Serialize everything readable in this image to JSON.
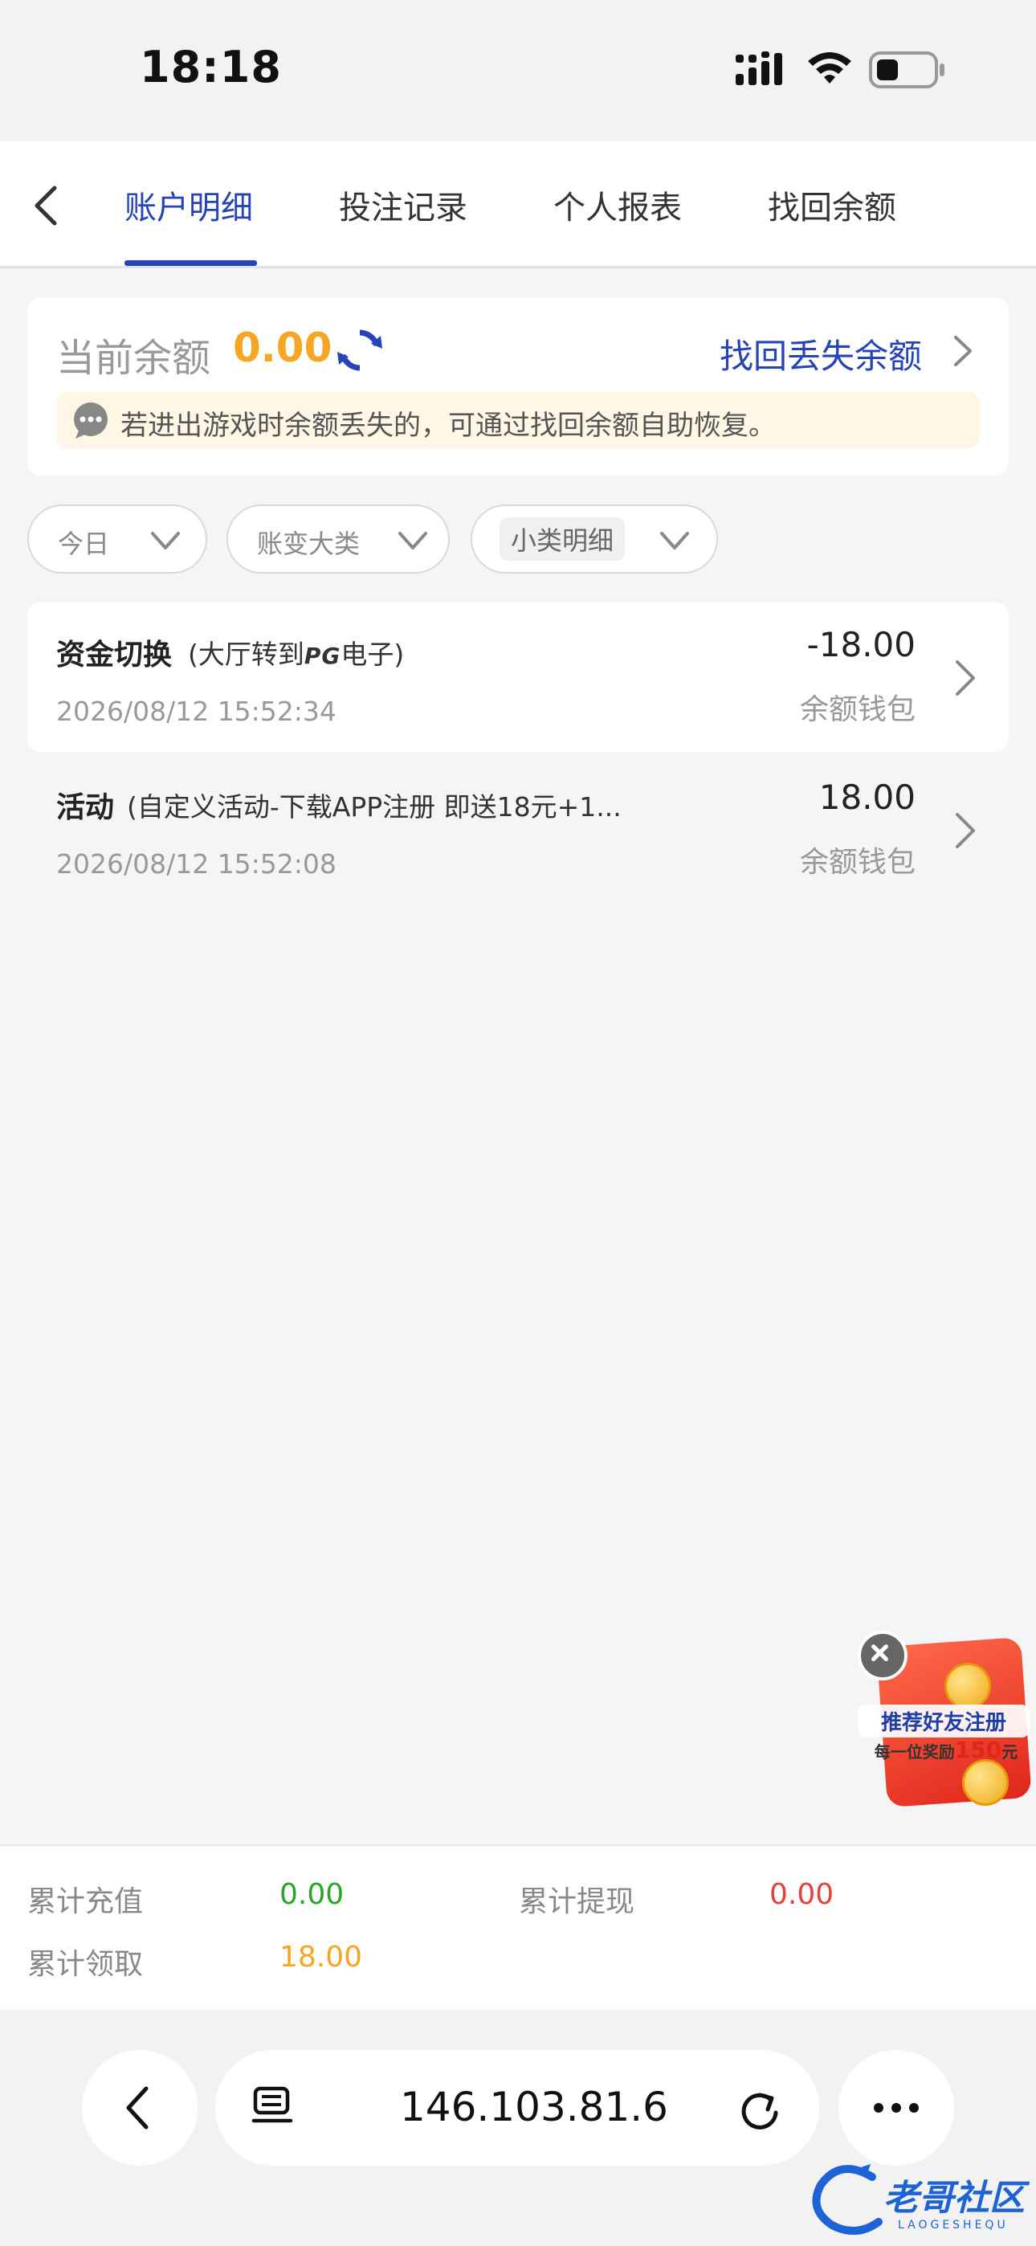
{
  "status_bar": {
    "time": "18:18"
  },
  "tabs": [
    {
      "label": "账户明细",
      "active": true
    },
    {
      "label": "投注记录",
      "active": false
    },
    {
      "label": "个人报表",
      "active": false
    },
    {
      "label": "找回余额",
      "active": false
    }
  ],
  "balance": {
    "label": "当前余额",
    "value": "0.00",
    "recover_link": "找回丢失余额",
    "notice": "若进出游戏时余额丢失的，可通过找回余额自助恢复。"
  },
  "filters": [
    {
      "label": "今日"
    },
    {
      "label": "账变大类"
    },
    {
      "label": "小类明细"
    }
  ],
  "records": [
    {
      "title": "资金切换",
      "sub_prefix": "(大厅转到",
      "sub_logo": "PG",
      "sub_suffix": "电子)",
      "time": "2026/08/12 15:52:34",
      "amount": "-18.00",
      "wallet": "余额钱包"
    },
    {
      "title": "活动",
      "sub": "(自定义活动-下载APP注册 即送18元+1...",
      "time": "2026/08/12 15:52:08",
      "amount": "18.00",
      "wallet": "余额钱包"
    }
  ],
  "promo": {
    "title": "推荐好友注册",
    "sub_prefix": "每一位奖励",
    "sub_amount": "150",
    "sub_suffix": "元"
  },
  "footer": {
    "total_deposit_label": "累计充值",
    "total_deposit_value": "0.00",
    "total_withdraw_label": "累计提现",
    "total_withdraw_value": "0.00",
    "total_claim_label": "累计领取",
    "total_claim_value": "18.00"
  },
  "browser": {
    "url": "146.103.81.6"
  },
  "watermark": {
    "text": "老哥社区",
    "sub": "LAOGESHEQU"
  },
  "colors": {
    "accent": "#2743b8",
    "amount_orange": "#f5a623",
    "green": "#2aa52a",
    "red": "#e0443a"
  }
}
